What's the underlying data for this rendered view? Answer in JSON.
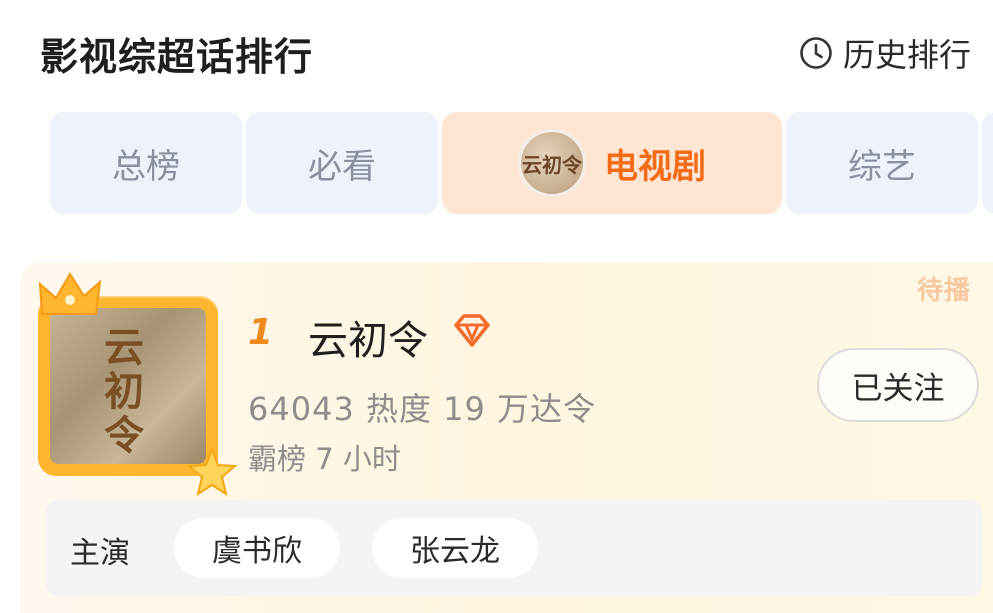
{
  "header": {
    "title": "影视综超话排行",
    "history_label": "历史排行",
    "history_icon": "clock-icon"
  },
  "tabs": [
    {
      "label": "总榜",
      "active": false
    },
    {
      "label": "必看",
      "active": false
    },
    {
      "label": "电视剧",
      "active": true
    },
    {
      "label": "综艺",
      "active": false
    }
  ],
  "accent_color": "#f46a16",
  "entry": {
    "status_badge": "待播",
    "rank": "1",
    "title": "云初令",
    "cover_text": "云初令",
    "stats": "64043 热度 19 万达令",
    "reign": "霸榜 7 小时",
    "follow_label": "已关注",
    "cast_label": "主演",
    "cast": [
      "虞书欣",
      "张云龙"
    ]
  }
}
